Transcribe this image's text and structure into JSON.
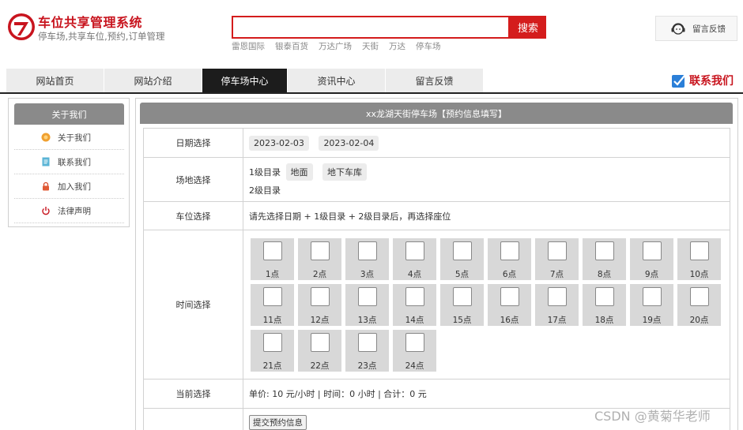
{
  "header": {
    "title": "车位共享管理系统",
    "subtitle": "停车场,共享车位,预约,订单管理",
    "search": {
      "value": "",
      "button": "搜索"
    },
    "hot_keywords": [
      "雷恩国际",
      "银泰百货",
      "万达广场",
      "天街",
      "万达",
      "停车场"
    ],
    "feedback_button": "留言反馈"
  },
  "nav": {
    "items": [
      "网站首页",
      "网站介绍",
      "停车场中心",
      "资讯中心",
      "留言反馈"
    ],
    "active_index": 2,
    "contact": "联系我们"
  },
  "sidebar": {
    "title": "关于我们",
    "items": [
      {
        "label": "关于我们",
        "icon": "orange-circle-icon"
      },
      {
        "label": "联系我们",
        "icon": "document-icon"
      },
      {
        "label": "加入我们",
        "icon": "lock-icon"
      },
      {
        "label": "法律声明",
        "icon": "power-icon"
      }
    ]
  },
  "main": {
    "title": "xx龙湖天街停车场【预约信息填写】",
    "rows": {
      "date": {
        "label": "日期选择",
        "options": [
          "2023-02-03",
          "2023-02-04"
        ]
      },
      "venue": {
        "label": "场地选择",
        "level1": "1级目录",
        "level1_options": [
          "地面",
          "地下车库"
        ],
        "level2": "2级目录"
      },
      "space": {
        "label": "车位选择",
        "text": "请先选择日期 + 1级目录 + 2级目录后，再选择座位"
      },
      "time": {
        "label": "时间选择",
        "slots": [
          "1点",
          "2点",
          "3点",
          "4点",
          "5点",
          "6点",
          "7点",
          "8点",
          "9点",
          "10点",
          "11点",
          "12点",
          "13点",
          "14点",
          "15点",
          "16点",
          "17点",
          "18点",
          "19点",
          "20点",
          "21点",
          "22点",
          "23点",
          "24点"
        ]
      },
      "current": {
        "label": "当前选择",
        "text": "单价: 10 元/小时 | 时间：0 小时 | 合计：0 元"
      },
      "submit": {
        "button": "提交预约信息"
      }
    }
  },
  "watermark": "CSDN @黄菊华老师",
  "colors": {
    "brand_red": "#d41c1c",
    "nav_active": "#1c1c1c",
    "panel_header": "#8a8a8a"
  }
}
